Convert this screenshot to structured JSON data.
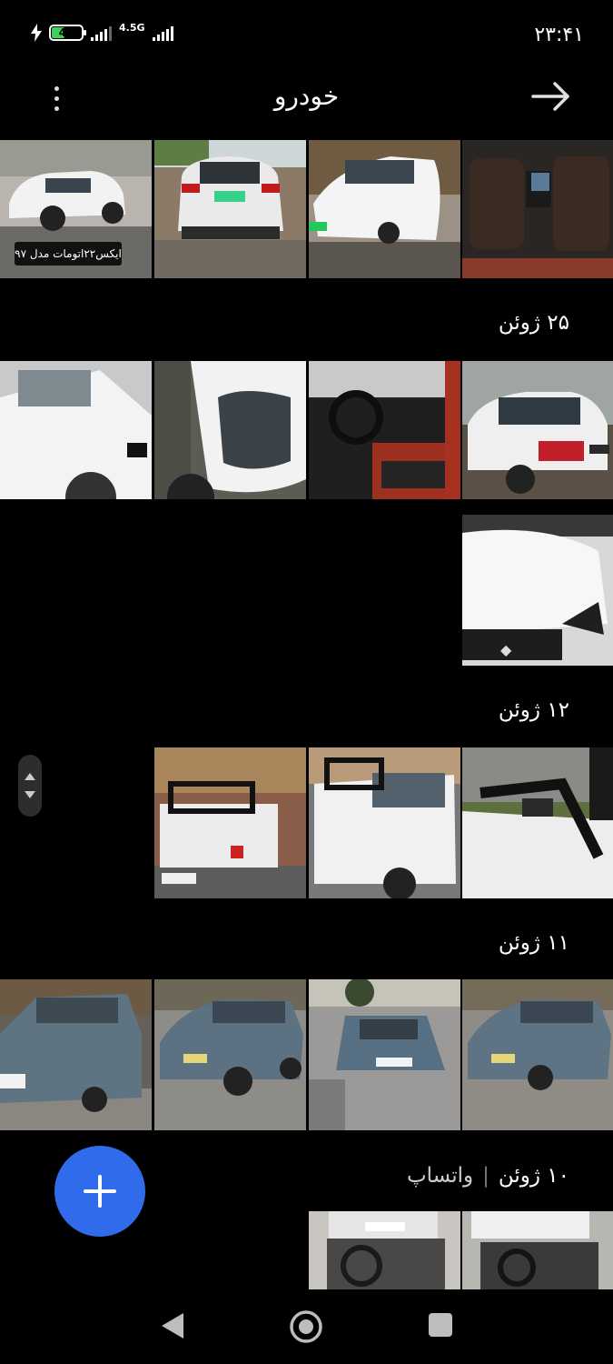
{
  "status_bar": {
    "battery": "42",
    "network": "4.5G",
    "time": "۲۳:۴۱"
  },
  "app_bar": {
    "title": "خودرو",
    "menu_icon": "more-vert-icon",
    "back_icon": "arrow-forward-icon"
  },
  "photos_top": {
    "overlay_text": "ایکس۲۲اتومات مدل ۹۷"
  },
  "sections": [
    {
      "date": "۲۵ ژوئن"
    },
    {
      "date": "۱۲ ژوئن"
    },
    {
      "date": "۱۱ ژوئن"
    },
    {
      "date": "۱۰ ژوئن",
      "sub_label": "واتساپ",
      "divider": "|"
    }
  ],
  "fab": {
    "icon": "add-icon"
  },
  "nav": {
    "back_icon": "nav-back-icon",
    "home_icon": "nav-home-icon",
    "recents_icon": "nav-recents-icon"
  },
  "colors": {
    "accent": "#2f6bea",
    "background": "#000000"
  }
}
